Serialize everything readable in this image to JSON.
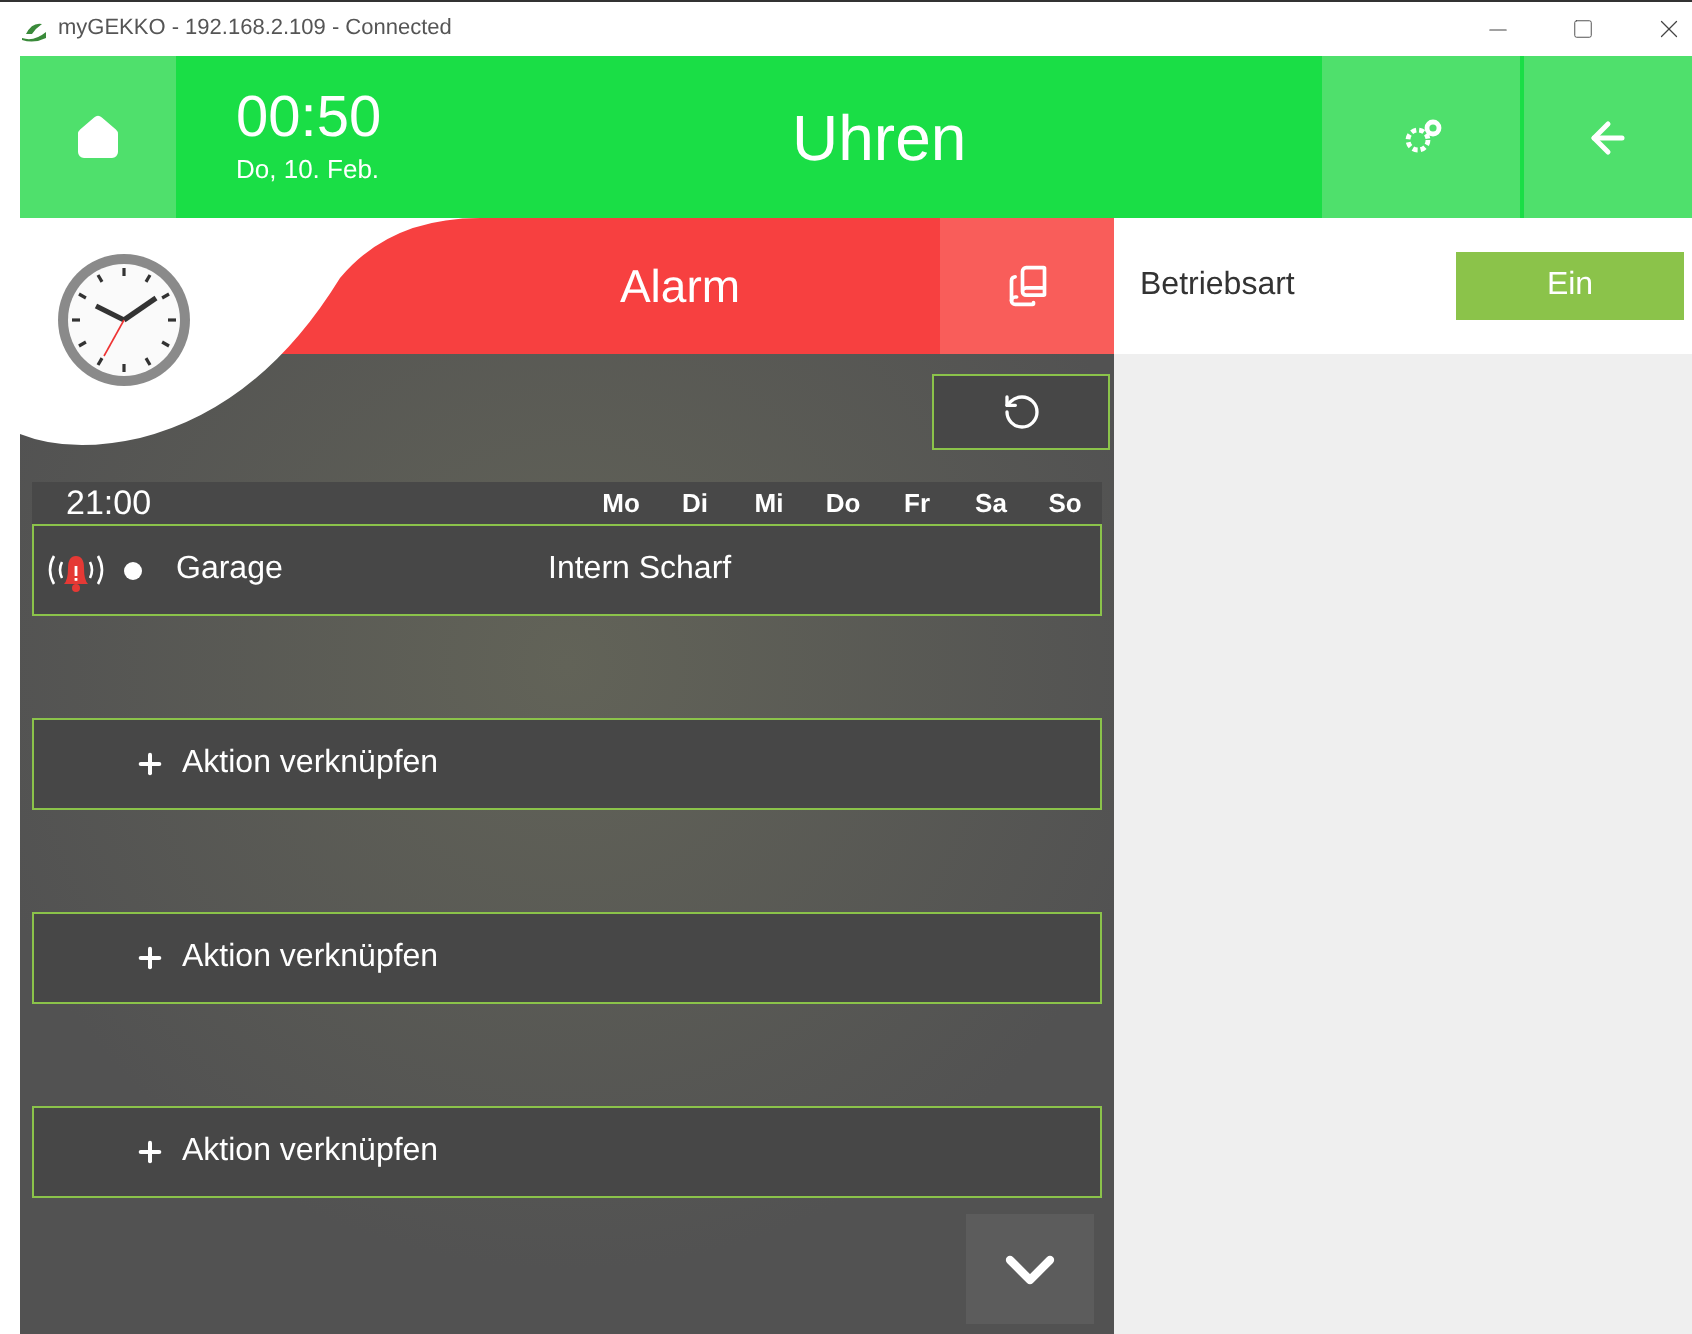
{
  "window": {
    "title": "myGEKKO - 192.168.2.109 - Connected"
  },
  "header": {
    "time": "00:50",
    "date": "Do, 10. Feb.",
    "title": "Uhren"
  },
  "panel": {
    "title": "Alarm",
    "time": "21:00",
    "days": [
      "Mo",
      "Di",
      "Mi",
      "Do",
      "Fr",
      "Sa",
      "So"
    ],
    "entries": [
      {
        "name": "Garage",
        "action": "Intern Scharf"
      }
    ],
    "actions": [
      "Aktion verknüpfen",
      "Aktion verknüpfen",
      "Aktion verknüpfen"
    ]
  },
  "settings": [
    {
      "label": "Betriebsart",
      "value": "Ein"
    }
  ]
}
